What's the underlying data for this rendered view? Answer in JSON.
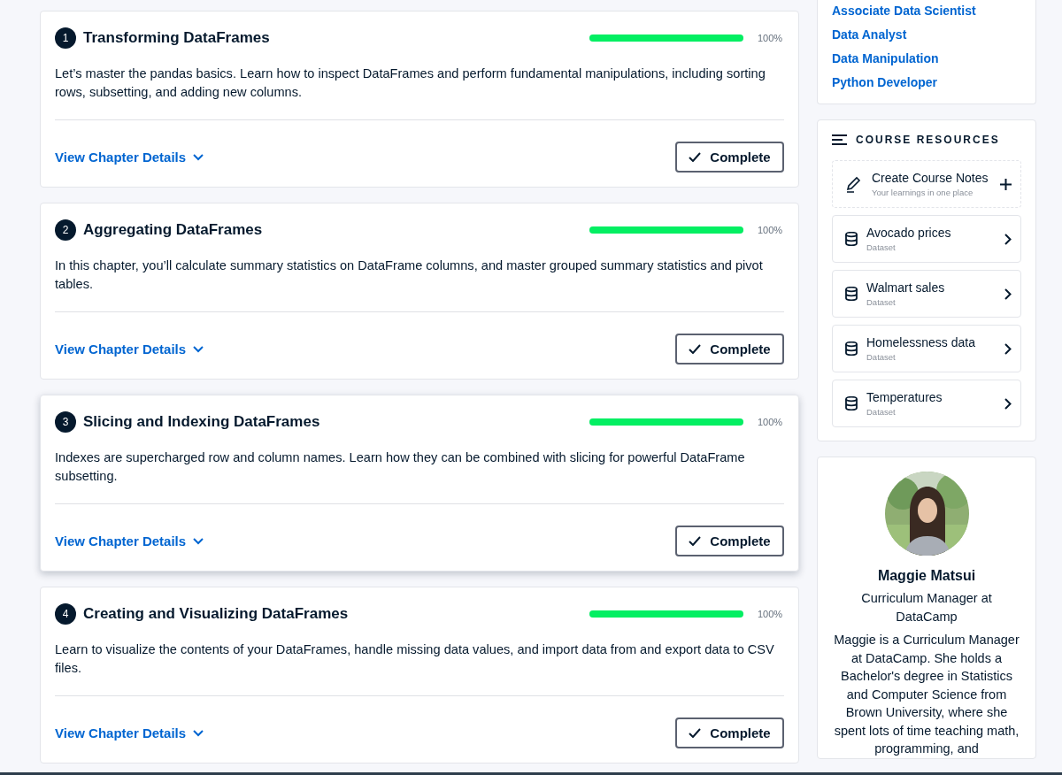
{
  "chapters": [
    {
      "number": "1",
      "title": "Transforming DataFrames",
      "level": 1,
      "reading": "100%",
      "hovered": false,
      "description": "Let’s master the pandas basics. Learn how to inspect DataFrames and perform fundamental manipulations, including sorting rows, subsetting, and adding new columns.",
      "details_link": "View Chapter Details",
      "button": {
        "label": "Complete",
        "completed": true
      }
    },
    {
      "number": "2",
      "title": "Aggregating DataFrames",
      "level": 1,
      "reading": "100%",
      "hovered": false,
      "description": "In this chapter, you’ll calculate summary statistics on DataFrame columns, and master grouped summary statistics and pivot tables.",
      "details_link": "View Chapter Details",
      "button": {
        "label": "Complete",
        "completed": true
      }
    },
    {
      "number": "3",
      "title": "Slicing and Indexing DataFrames",
      "level": 1,
      "reading": "100%",
      "hovered": true,
      "description": "Indexes are supercharged row and column names. Learn how they can be combined with slicing for powerful DataFrame subsetting.",
      "details_link": "View Chapter Details",
      "button": {
        "label": "Complete",
        "completed": true
      }
    },
    {
      "number": "4",
      "title": "Creating and Visualizing DataFrames",
      "level": 1,
      "reading": "100%",
      "hovered": false,
      "description": "Learn to visualize the contents of your DataFrames, handle missing data values, and import data from and export data to CSV files.",
      "details_link": "View Chapter Details",
      "button": {
        "label": "Complete",
        "completed": true
      }
    }
  ],
  "tracks": {
    "links": [
      "Associate Data Scientist",
      "Data Analyst",
      "Data Manipulation",
      "Python Developer"
    ]
  },
  "resources": {
    "title": "COURSE RESOURCES",
    "notes": {
      "title": "Create Course Notes",
      "subtitle": "Your learnings in one place"
    },
    "items": [
      {
        "name": "Avocado prices",
        "type": "Dataset"
      },
      {
        "name": "Walmart sales",
        "type": "Dataset"
      },
      {
        "name": "Homelessness data",
        "type": "Dataset"
      },
      {
        "name": "Temperatures",
        "type": "Dataset"
      }
    ]
  },
  "instructor": {
    "name": "Maggie Matsui",
    "role": "Curriculum Manager at DataCamp",
    "bio": "Maggie is a Curriculum Manager at DataCamp. She holds a Bachelor's degree in Statistics and Computer Science from Brown University, where she spent lots of time teaching math, programming, and"
  }
}
